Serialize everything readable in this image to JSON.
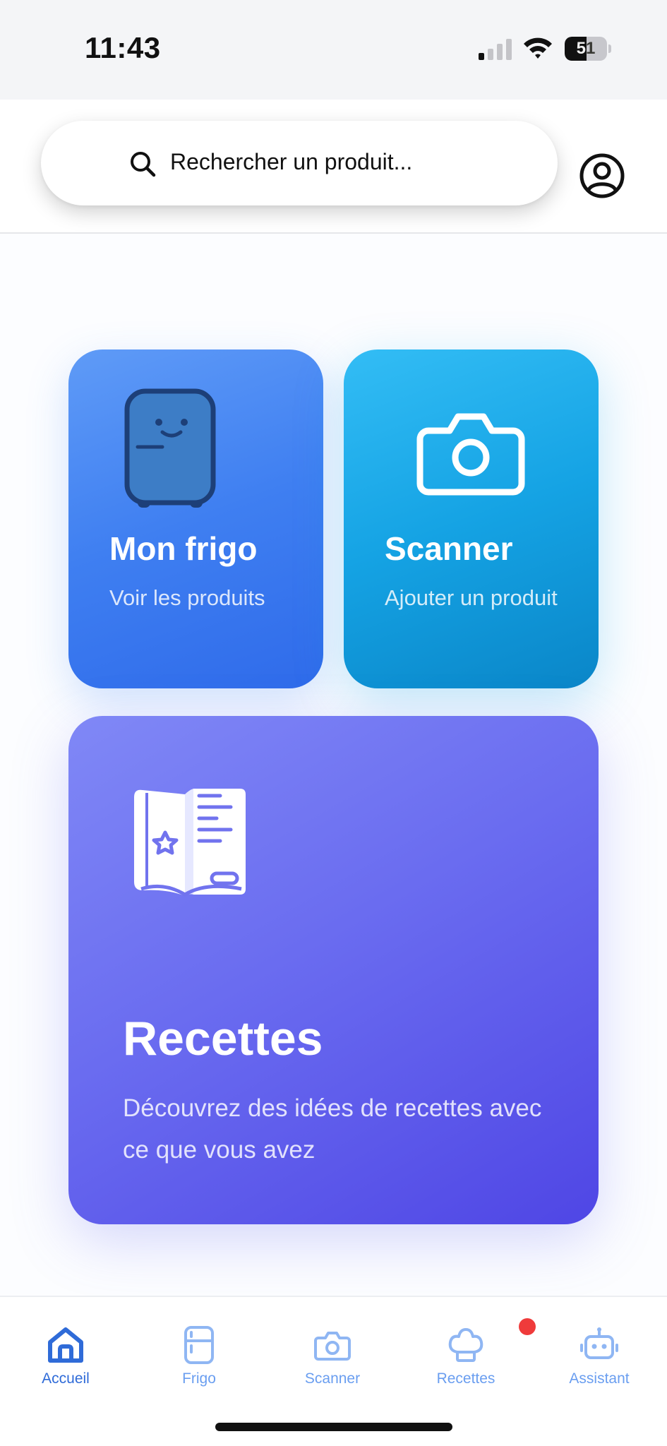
{
  "status_bar": {
    "time": "11:43",
    "battery_level": "51",
    "battery_fraction": 0.51
  },
  "header": {
    "search_placeholder": "Rechercher un produit..."
  },
  "cards": {
    "frigo": {
      "title": "Mon frigo",
      "subtitle": "Voir les produits",
      "icon": "fridge-icon"
    },
    "scanner": {
      "title": "Scanner",
      "subtitle": "Ajouter un produit",
      "icon": "camera-icon"
    },
    "recettes": {
      "title": "Recettes",
      "subtitle": "Découvrez des idées de recettes avec ce que vous avez",
      "icon": "recipe-book-icon"
    }
  },
  "bottom_nav": {
    "items": [
      {
        "label": "Accueil",
        "icon": "home-icon",
        "active": true
      },
      {
        "label": "Frigo",
        "icon": "fridge-icon"
      },
      {
        "label": "Scanner",
        "icon": "camera-icon"
      },
      {
        "label": "Recettes",
        "icon": "chef-hat-icon"
      },
      {
        "label": "Assistant",
        "icon": "robot-icon",
        "has_badge": true
      }
    ]
  },
  "colors": {
    "frigo_card": "#3f7ff1",
    "scanner_card": "#15a3e4",
    "recettes_card": "#5b5cec",
    "nav_active": "#2f6bd8",
    "nav_inactive": "#6a9ef0",
    "badge": "#ef3b3b"
  }
}
